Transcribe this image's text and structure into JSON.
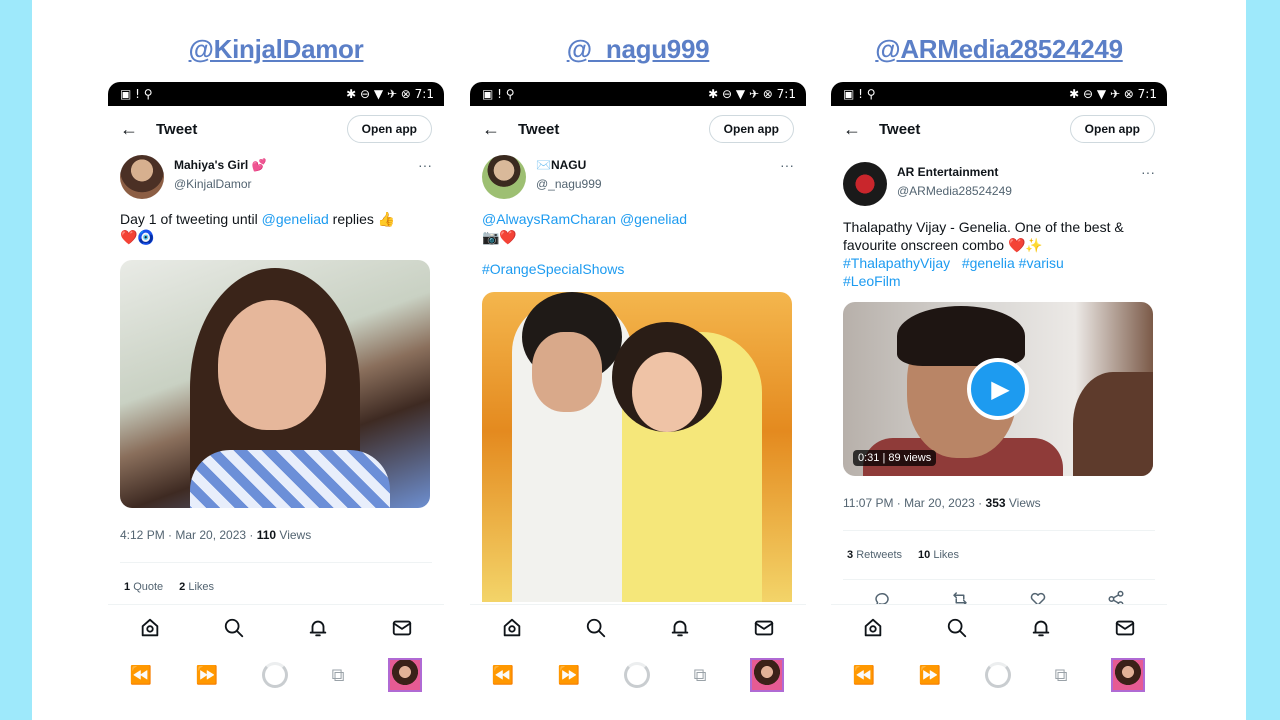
{
  "columns": [
    {
      "handle": "@KinjalDamor",
      "status": {
        "left": "▣ ! ⚲",
        "right": "✱ ⊖ ▼ ✈ ⊗ 7:1"
      },
      "header": {
        "title": "Tweet",
        "open_app": "Open app"
      },
      "author": {
        "display_name": "Mahiya's Girl 💕",
        "username": "@KinjalDamor"
      },
      "text_parts": [
        "Day 1 of tweeting until ",
        "@geneliad",
        " replies 👍",
        "❤️🧿"
      ],
      "meta": {
        "time": "4:12 PM · Mar 20, 2023 · ",
        "views_count": "110",
        "views_label": " Views"
      },
      "stats": [
        {
          "count": "1",
          "label": "Quote"
        },
        {
          "count": "2",
          "label": "Likes"
        }
      ]
    },
    {
      "handle": "@_nagu999",
      "status": {
        "left": "▣ ! ⚲",
        "right": "✱ ⊖ ▼ ✈ ⊗ 7:1"
      },
      "header": {
        "title": "Tweet",
        "open_app": "Open app"
      },
      "author": {
        "display_name": "✉️NAGU",
        "username": "@_nagu999"
      },
      "text_parts": [
        "@AlwaysRamCharan",
        " ",
        "@geneliad",
        "📷❤️",
        "#OrangeSpecialShows"
      ]
    },
    {
      "handle": "@ARMedia28524249",
      "status": {
        "left": "▣ ! ⚲",
        "right": "✱ ⊖ ▼ ✈ ⊗ 7:1"
      },
      "header": {
        "title": "Tweet",
        "open_app": "Open app"
      },
      "author": {
        "display_name": "AR Entertainment",
        "username": "@ARMedia28524249"
      },
      "text_parts": [
        "Thalapathy Vijay - Genelia. One of the best & favourite onscreen combo ❤️✨",
        "#ThalapathyVijay",
        "#genelia",
        "#varisu",
        "#LeoFilm"
      ],
      "video": {
        "duration": "0:31",
        "views": "89 views"
      },
      "meta": {
        "time": "11:07 PM · Mar 20, 2023 · ",
        "views_count": "353",
        "views_label": " Views"
      },
      "stats": [
        {
          "count": "3",
          "label": "Retweets"
        },
        {
          "count": "10",
          "label": "Likes"
        }
      ]
    }
  ],
  "colors": {
    "background": "#9ee9fb",
    "handle": "#5b7fc7",
    "link": "#1d9bf0"
  },
  "icons": [
    "arrow-left-icon",
    "more-icon",
    "home-icon",
    "search-icon",
    "bell-icon",
    "mail-icon",
    "reply-icon",
    "retweet-icon",
    "like-icon",
    "share-icon",
    "rewind-icon",
    "fast-forward-icon",
    "loading-icon",
    "cast-icon"
  ]
}
